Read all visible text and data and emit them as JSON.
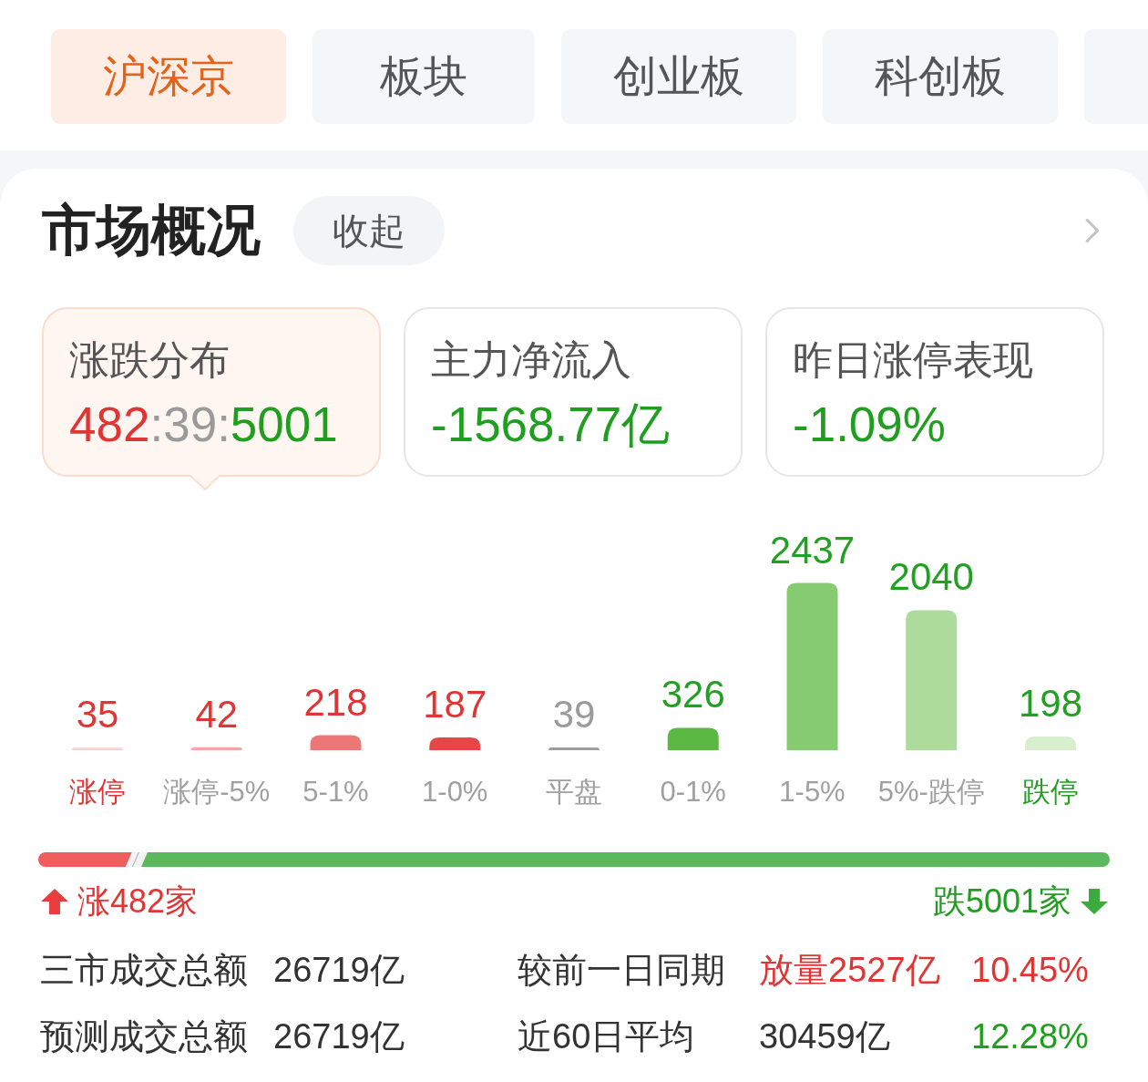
{
  "tabs": [
    {
      "label": "沪深京",
      "selected": true
    },
    {
      "label": "板块",
      "selected": false
    },
    {
      "label": "创业板",
      "selected": false
    },
    {
      "label": "科创板",
      "selected": false
    }
  ],
  "partial_tab": {
    "selected": false
  },
  "section": {
    "title": "市场概况",
    "collapse_button": "收起"
  },
  "summary_cards": [
    {
      "label": "涨跌分布",
      "selected": true,
      "value_parts": [
        {
          "text": "482",
          "color": "#e03535"
        },
        {
          "text": ":",
          "color": "#9a9a9a"
        },
        {
          "text": "39",
          "color": "#9a9a9a"
        },
        {
          "text": ":",
          "color": "#9a9a9a"
        },
        {
          "text": "5001",
          "color": "#1f9e1f"
        }
      ]
    },
    {
      "label": "主力净流入",
      "selected": false,
      "value_parts": [
        {
          "text": "-1568.77亿",
          "color": "#1f9e1f"
        }
      ]
    },
    {
      "label": "昨日涨停表现",
      "selected": false,
      "value_parts": [
        {
          "text": "-1.09%",
          "color": "#1f9e1f"
        }
      ]
    }
  ],
  "distribution": {
    "chart_data": {
      "type": "bar",
      "categories": [
        "涨停",
        "涨停-5%",
        "5-1%",
        "1-0%",
        "平盘",
        "0-1%",
        "1-5%",
        "5%-跌停",
        "跌停"
      ],
      "values": [
        35,
        42,
        218,
        187,
        39,
        326,
        2437,
        2040,
        198
      ],
      "data_labels": true
    },
    "bar_styles": [
      {
        "color": "#f9d2d2",
        "kind": "up",
        "highlighted": true
      },
      {
        "color": "#f4a6a6",
        "kind": "up",
        "highlighted": false
      },
      {
        "color": "#ef7676",
        "kind": "up",
        "highlighted": false
      },
      {
        "color": "#e84646",
        "kind": "up",
        "highlighted": false
      },
      {
        "color": "#9e9e9e",
        "kind": "flat",
        "highlighted": false
      },
      {
        "color": "#5ab843",
        "kind": "down",
        "highlighted": false
      },
      {
        "color": "#86cb72",
        "kind": "down",
        "highlighted": false
      },
      {
        "color": "#acdb9c",
        "kind": "down",
        "highlighted": false
      },
      {
        "color": "#d7efcd",
        "kind": "down",
        "highlighted": true
      }
    ]
  },
  "breadth_bar": {
    "segments": [
      {
        "kind": "up",
        "level": 0.0873
      },
      {
        "kind": "flat",
        "level": 0.0071
      },
      {
        "kind": "down",
        "level": 0.9056
      }
    ]
  },
  "breadth_legend": {
    "up_text": "涨482家",
    "down_text": "跌5001家"
  },
  "turnover_rows": [
    {
      "label": "三市成交总额",
      "value": "26719亿",
      "compare_label": "较前一日同期",
      "compare_values": [
        {
          "text": "放量2527亿",
          "color": "#e03535"
        },
        {
          "text": "10.45%",
          "color": "#e03535"
        }
      ]
    },
    {
      "label": "预测成交总额",
      "value": "26719亿",
      "compare_label": "近60日平均",
      "compare_values": [
        {
          "text": "30459亿",
          "color": "#333333"
        },
        {
          "text": "12.28%",
          "color": "#1f9e1f"
        }
      ]
    }
  ]
}
